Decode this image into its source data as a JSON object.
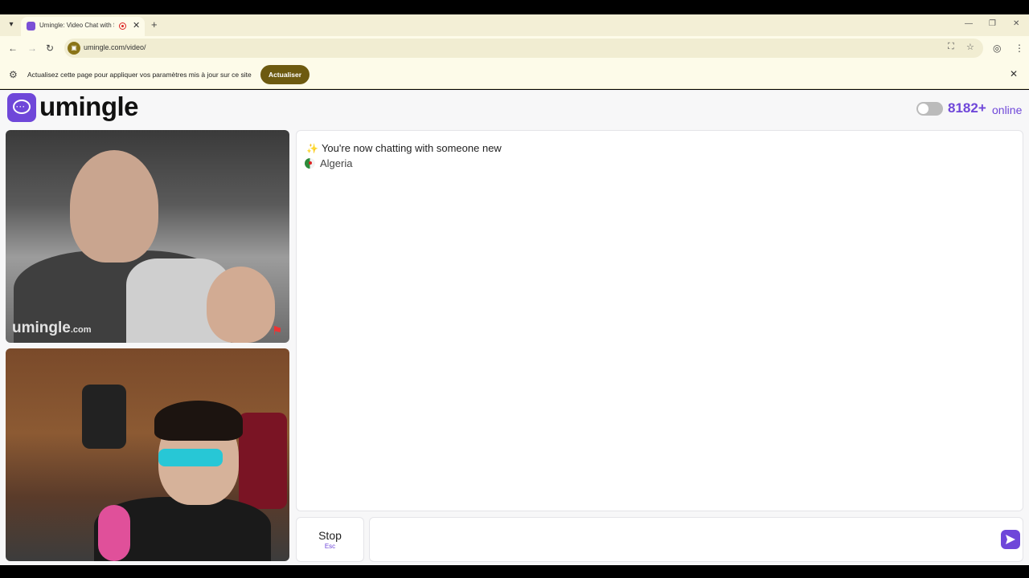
{
  "browser": {
    "tab_title": "Umingle: Video Chat with S",
    "tab_close": "✕",
    "new_tab": "+",
    "url": "umingle.com/video/",
    "icons": [
      "back-icon",
      "forward-icon",
      "reload-icon",
      "translate-icon",
      "star-icon",
      "profile-icon",
      "menu-icon"
    ]
  },
  "infobar": {
    "message": "Actualisez cette page pour appliquer vos paramètres mis à jour sur ce site",
    "button_label": "Actualiser",
    "close": "✕"
  },
  "header": {
    "logo_text": "umingle",
    "online_count": "8182+",
    "online_label": "online",
    "toggle_on": false
  },
  "video": {
    "watermark_main": "umingle",
    "watermark_suffix": ".com"
  },
  "chat": {
    "system_message": "You're now chatting with someone new",
    "country": "Algeria"
  },
  "controls": {
    "stop_label": "Stop",
    "stop_key": "Esc",
    "message_placeholder": ""
  },
  "colors": {
    "brand": "#6f47d9",
    "infobar_button": "#6d5a10"
  }
}
